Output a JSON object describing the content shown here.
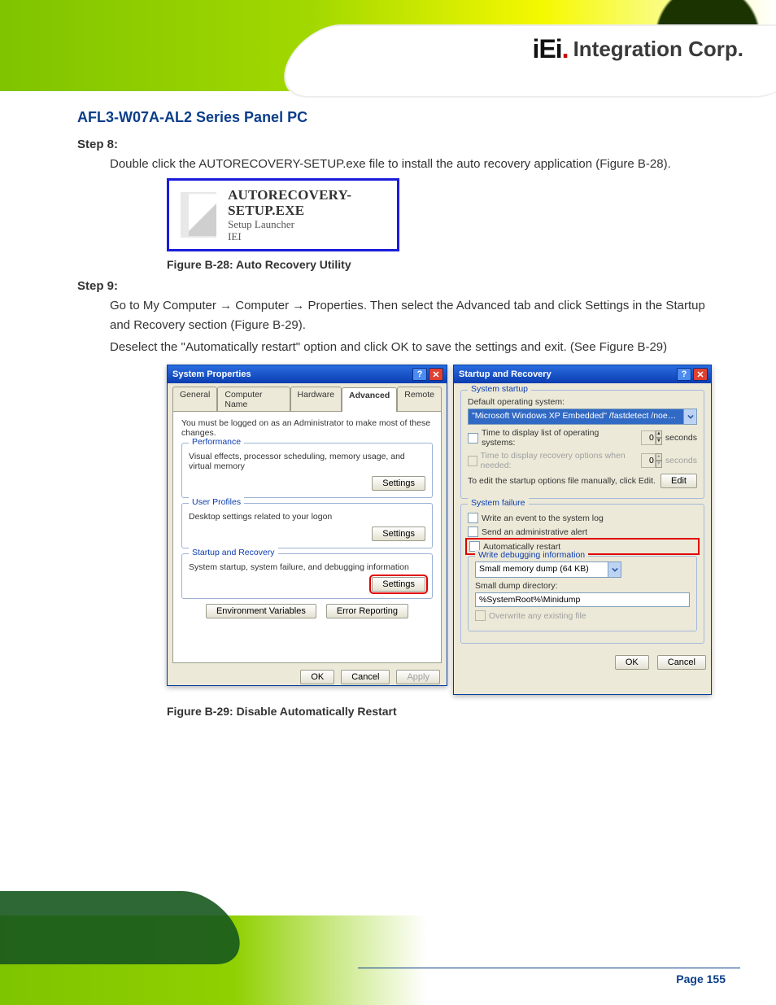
{
  "brand": {
    "iei": "iEi",
    "rest": "Integration Corp."
  },
  "doc_title": "AFL3-W07A-AL2 Series Panel PC",
  "step8": {
    "label": "Step 8:",
    "text": "Double click the AUTORECOVERY-SETUP.exe file to install the auto recovery application (Figure B-28)."
  },
  "fig28": {
    "label": "Figure B-28: Auto Recovery Utility",
    "line1": "AUTORECOVERY-SETUP.EXE",
    "line2": "Setup Launcher",
    "line3": "IEI"
  },
  "step9": {
    "label": "Step 9:",
    "text_before": "Go to My Computer",
    "arrow": "→",
    "computer": "Computer",
    "properties": "Properties",
    "after": ". Then select the Advanced tab and click Settings in the Startup and Recovery section (Figure B-29)."
  },
  "step9b": "Deselect the \"Automatically restart\" option and click OK to save the settings and exit. (See Figure B-29)",
  "fig29": {
    "label": "Figure B-29: Disable Automatically Restart"
  },
  "page_num": "Page 155",
  "sysprop": {
    "title": "System Properties",
    "tabs": [
      "General",
      "Computer Name",
      "Hardware",
      "Advanced",
      "Remote"
    ],
    "active_tab": 3,
    "note": "You must be logged on as an Administrator to make most of these changes.",
    "perf": {
      "legend": "Performance",
      "desc": "Visual effects, processor scheduling, memory usage, and virtual memory",
      "btn": "Settings"
    },
    "profiles": {
      "legend": "User Profiles",
      "desc": "Desktop settings related to your logon",
      "btn": "Settings"
    },
    "startup": {
      "legend": "Startup and Recovery",
      "desc": "System startup, system failure, and debugging information",
      "btn": "Settings"
    },
    "envvar": "Environment Variables",
    "errrep": "Error Reporting",
    "ok": "OK",
    "cancel": "Cancel",
    "apply": "Apply"
  },
  "startup": {
    "title": "Startup and Recovery",
    "sys_legend": "System startup",
    "default_os_label": "Default operating system:",
    "default_os": "\"Microsoft Windows XP Embedded\" /fastdetect /noexecute=Alwa",
    "chk_oslist": "Time to display list of operating systems:",
    "sec": "seconds",
    "chk_recovery": "Time to display recovery options when needed:",
    "edithint": "To edit the startup options file manually, click Edit.",
    "edit": "Edit",
    "fail_legend": "System failure",
    "evt": "Write an event to the system log",
    "alert": "Send an administrative alert",
    "auto": "Automatically restart",
    "write_legend": "Write debugging information",
    "dump_type": "Small memory dump (64 KB)",
    "dump_dir_label": "Small dump directory:",
    "dump_dir": "%SystemRoot%\\Minidump",
    "overwrite": "Overwrite any existing file",
    "ok": "OK",
    "cancel": "Cancel",
    "spin_val": "0"
  }
}
